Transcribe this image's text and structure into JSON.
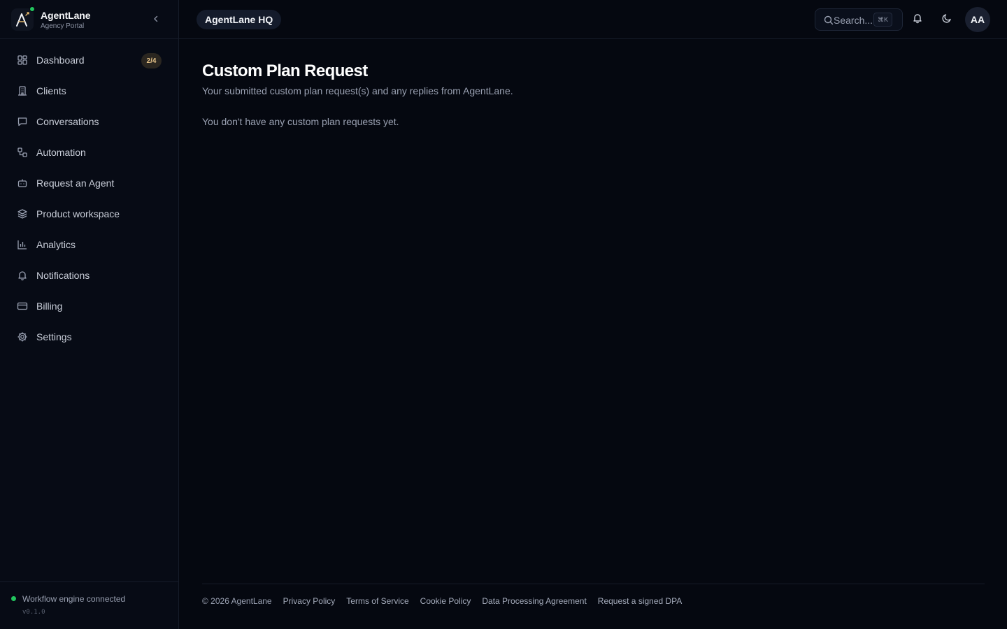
{
  "brand": {
    "name": "AgentLane",
    "subtitle": "Agency Portal"
  },
  "sidebar": {
    "items": [
      {
        "label": "Dashboard",
        "icon": "grid-icon",
        "badge": "2/4"
      },
      {
        "label": "Clients",
        "icon": "building-icon"
      },
      {
        "label": "Conversations",
        "icon": "chat-icon"
      },
      {
        "label": "Automation",
        "icon": "workflow-icon"
      },
      {
        "label": "Request an Agent",
        "icon": "bot-icon"
      },
      {
        "label": "Product workspace",
        "icon": "layers-icon"
      },
      {
        "label": "Analytics",
        "icon": "bar-chart-icon"
      },
      {
        "label": "Notifications",
        "icon": "bell-icon"
      },
      {
        "label": "Billing",
        "icon": "credit-card-icon"
      },
      {
        "label": "Settings",
        "icon": "gear-icon"
      }
    ],
    "status": {
      "text": "Workflow engine connected",
      "version": "v0.1.0",
      "color": "#22c55e"
    }
  },
  "topbar": {
    "workspace": "AgentLane HQ",
    "search": {
      "placeholder": "Search...",
      "shortcut": "⌘K"
    },
    "avatar_initials": "AA"
  },
  "main": {
    "title": "Custom Plan Request",
    "subtitle": "Your submitted custom plan request(s) and any replies from AgentLane.",
    "empty_message": "You don't have any custom plan requests yet."
  },
  "footer": {
    "copyright": "© 2026 AgentLane",
    "links": [
      "Privacy Policy",
      "Terms of Service",
      "Cookie Policy",
      "Data Processing Agreement",
      "Request a signed DPA"
    ]
  },
  "colors": {
    "background": "#050810",
    "sidebar": "#070b15",
    "badge_bg": "#2a2620",
    "badge_text": "#e7c48a",
    "status_green": "#22c55e"
  }
}
